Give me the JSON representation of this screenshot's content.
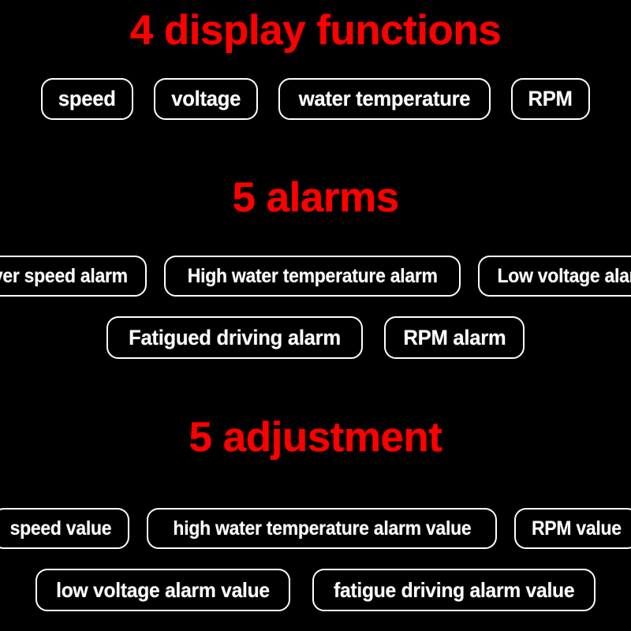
{
  "page": {
    "background_color": "#000000",
    "accent_color": "#ff0000",
    "pill_border_color": "#ffffff",
    "pill_text_color": "#ffffff"
  },
  "sections": [
    {
      "id": "display-functions",
      "title": "4 display functions",
      "rows": [
        {
          "id": "display-row-1",
          "items": [
            "speed",
            "voltage",
            "water temperature",
            "RPM"
          ]
        }
      ]
    },
    {
      "id": "alarms",
      "title": "5 alarms",
      "rows": [
        {
          "id": "alarm-row-1",
          "items": [
            "Over speed alarm",
            "High water temperature alarm",
            "Low voltage alarm"
          ]
        },
        {
          "id": "alarm-row-2",
          "items": [
            "Fatigued driving alarm",
            "RPM alarm"
          ]
        }
      ]
    },
    {
      "id": "adjustment",
      "title": "5 adjustment",
      "rows": [
        {
          "id": "adjust-row-1",
          "items": [
            "speed value",
            "high water temperature alarm value",
            "RPM value"
          ]
        },
        {
          "id": "adjust-row-2",
          "items": [
            "low voltage alarm value",
            "fatigue driving alarm value"
          ]
        }
      ]
    }
  ]
}
